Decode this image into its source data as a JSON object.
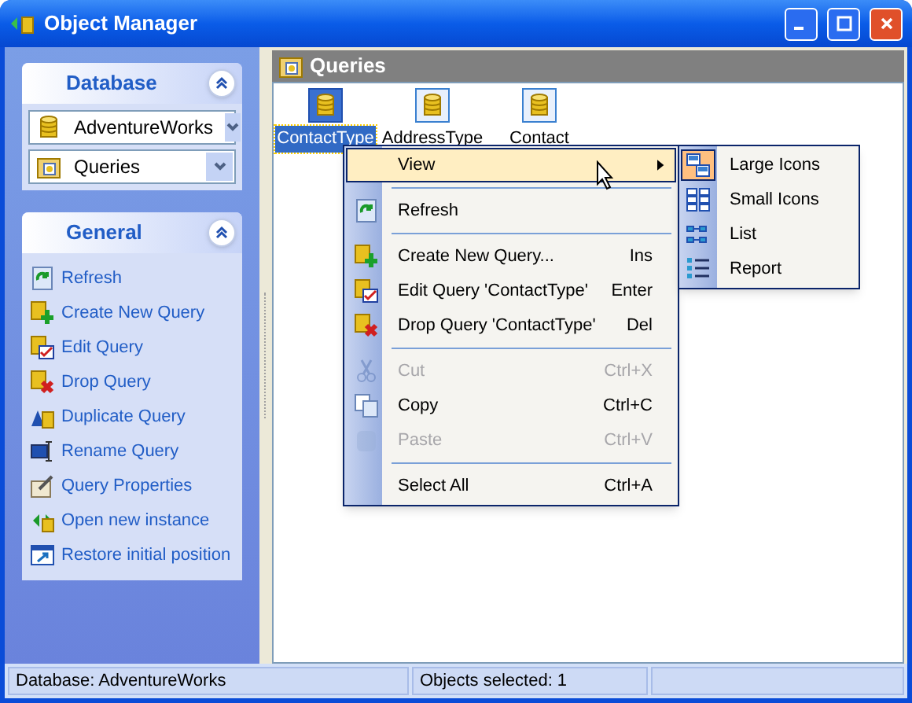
{
  "window": {
    "title": "Object Manager"
  },
  "database_panel": {
    "title": "Database",
    "expanded": true,
    "database": "AdventureWorks",
    "object_type": "Queries"
  },
  "general_panel": {
    "title": "General",
    "expanded": true,
    "links": [
      {
        "label": "Refresh"
      },
      {
        "label": "Create New Query"
      },
      {
        "label": "Edit Query"
      },
      {
        "label": "Drop Query"
      },
      {
        "label": "Duplicate Query"
      },
      {
        "label": "Rename Query"
      },
      {
        "label": "Query Properties"
      },
      {
        "label": "Open new instance"
      },
      {
        "label": "Restore initial position"
      }
    ]
  },
  "content": {
    "title": "Queries",
    "objects": [
      {
        "label": "ContactType",
        "selected": true
      },
      {
        "label": "AddressType",
        "selected": false
      },
      {
        "label": "Contact",
        "selected": false
      }
    ]
  },
  "context_menu": {
    "items": [
      {
        "kind": "item",
        "label": "View",
        "submenu": true,
        "selected": true,
        "disabled": false
      },
      {
        "kind": "separator"
      },
      {
        "kind": "item",
        "label": "Refresh",
        "submenu": false,
        "selected": false,
        "disabled": false
      },
      {
        "kind": "separator"
      },
      {
        "kind": "item",
        "label": "Create New Query...",
        "shortcut": "Ins",
        "submenu": false,
        "selected": false,
        "disabled": false
      },
      {
        "kind": "item",
        "label": "Edit Query 'ContactType'",
        "shortcut": "Enter",
        "submenu": false,
        "selected": false,
        "disabled": false
      },
      {
        "kind": "item",
        "label": "Drop Query 'ContactType'",
        "shortcut": "Del",
        "submenu": false,
        "selected": false,
        "disabled": false
      },
      {
        "kind": "separator"
      },
      {
        "kind": "item",
        "label": "Cut",
        "shortcut": "Ctrl+X",
        "submenu": false,
        "selected": false,
        "disabled": true
      },
      {
        "kind": "item",
        "label": "Copy",
        "shortcut": "Ctrl+C",
        "submenu": false,
        "selected": false,
        "disabled": false
      },
      {
        "kind": "item",
        "label": "Paste",
        "shortcut": "Ctrl+V",
        "submenu": false,
        "selected": false,
        "disabled": true
      },
      {
        "kind": "separator"
      },
      {
        "kind": "item",
        "label": "Select All",
        "shortcut": "Ctrl+A",
        "submenu": false,
        "selected": false,
        "disabled": false
      }
    ]
  },
  "view_submenu": {
    "items": [
      {
        "label": "Large Icons",
        "selected": true
      },
      {
        "label": "Small Icons",
        "selected": false
      },
      {
        "label": "List",
        "selected": false
      },
      {
        "label": "Report",
        "selected": false
      }
    ]
  },
  "status_bar": {
    "database": "Database: AdventureWorks",
    "selection": "Objects selected: 1"
  }
}
